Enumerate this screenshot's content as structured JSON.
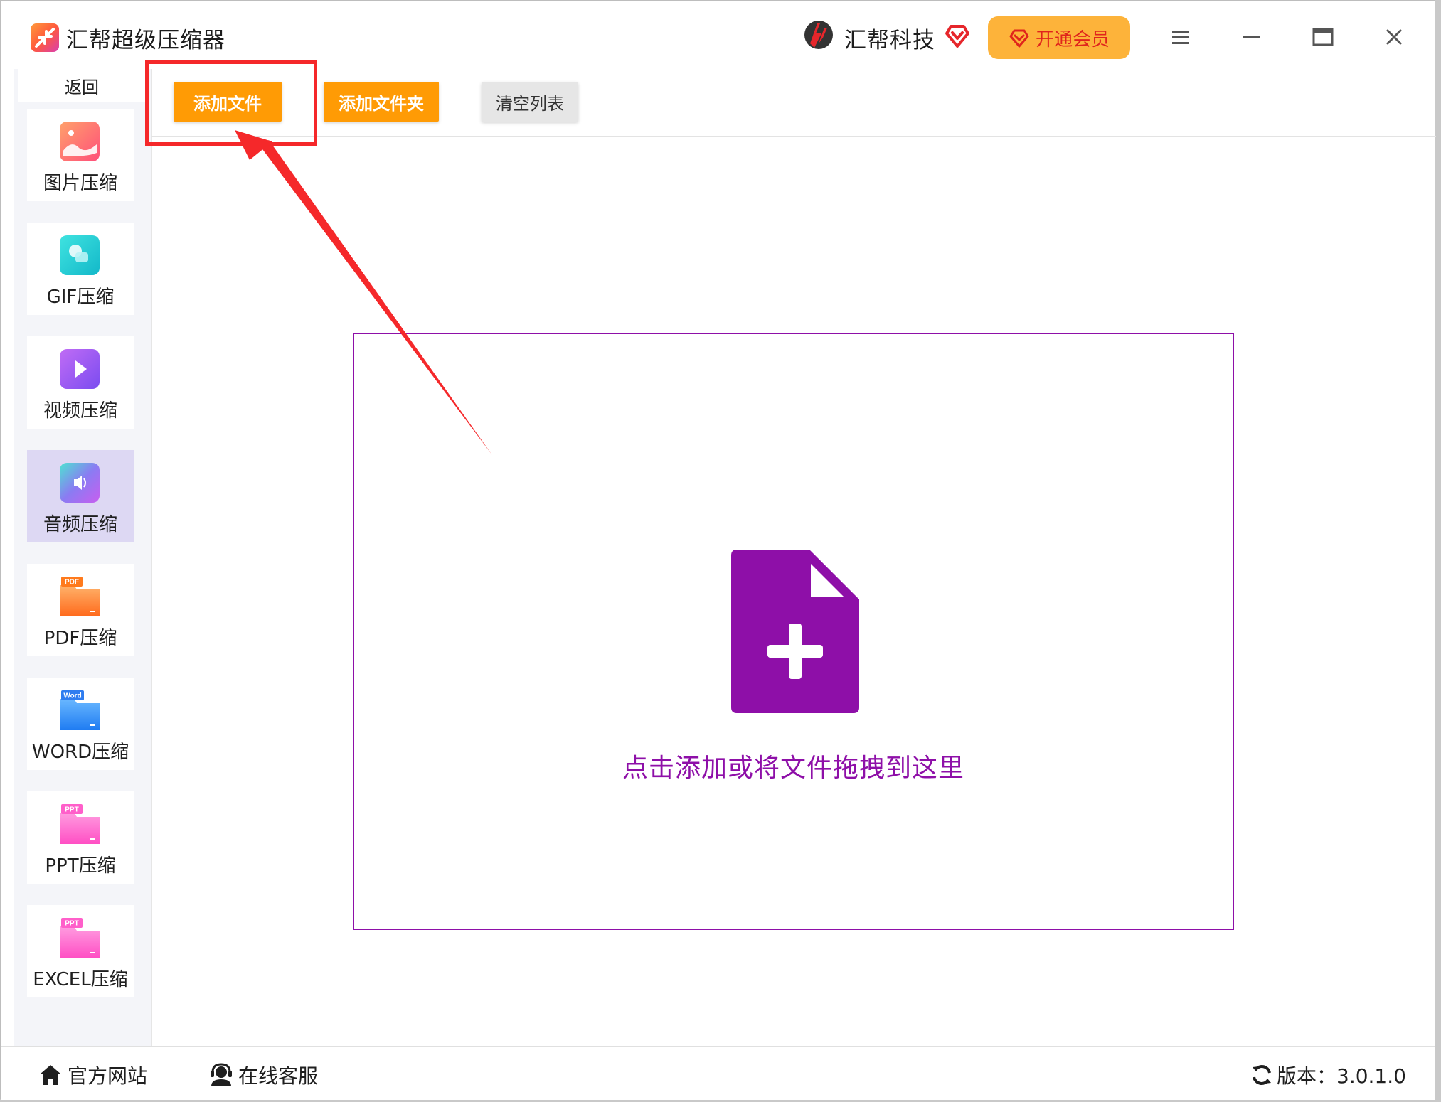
{
  "app": {
    "title": "汇帮超级压缩器",
    "brand_name": "汇帮科技",
    "vip_label": "开通会员"
  },
  "toolbar": {
    "add_file": "添加文件",
    "add_folder": "添加文件夹",
    "clear_list": "清空列表"
  },
  "sidebar": {
    "back": "返回",
    "items": [
      {
        "label": "图片压缩",
        "icon": "image-icon"
      },
      {
        "label": "GIF压缩",
        "icon": "gif-icon"
      },
      {
        "label": "视频压缩",
        "icon": "video-icon"
      },
      {
        "label": "音频压缩",
        "icon": "audio-icon",
        "active": true
      },
      {
        "label": "PDF压缩",
        "icon": "pdf-folder-icon",
        "badge": "PDF"
      },
      {
        "label": "WORD压缩",
        "icon": "word-folder-icon",
        "badge": "Word"
      },
      {
        "label": "PPT压缩",
        "icon": "ppt-folder-icon",
        "badge": "PPT"
      },
      {
        "label": "EXCEL压缩",
        "icon": "excel-folder-icon",
        "badge": "PPT"
      }
    ]
  },
  "dropzone": {
    "text": "点击添加或将文件拖拽到这里"
  },
  "footer": {
    "website": "官方网站",
    "support": "在线客服",
    "version": "版本：3.0.1.0"
  },
  "colors": {
    "accent_orange": "#ff9b05",
    "accent_purple": "#8e0fa8",
    "annotation_red": "#f5282a",
    "vip_bg": "#fdb33a"
  }
}
